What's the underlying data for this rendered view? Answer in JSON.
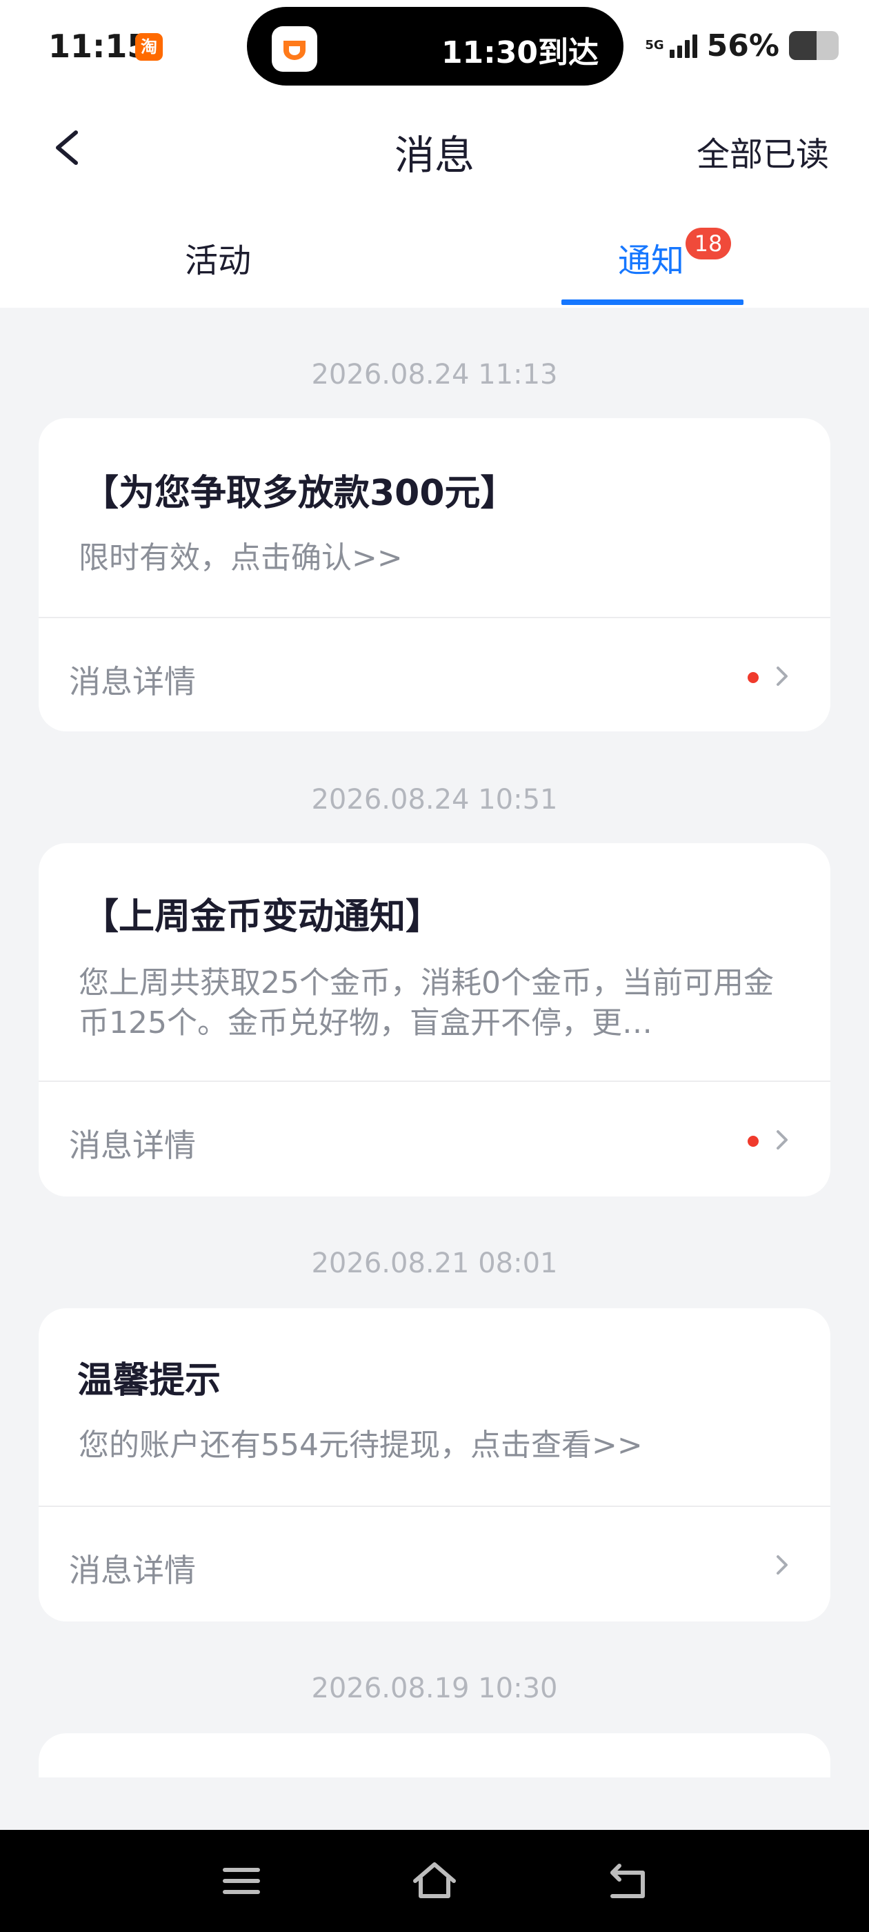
{
  "status_bar": {
    "time": "11:15",
    "app_badge": "淘",
    "island_text": "11:30到达",
    "network": "5G",
    "battery_percent": "56%",
    "battery_level": 0.56
  },
  "header": {
    "title": "消息",
    "read_all": "全部已读"
  },
  "tabs": {
    "activity": "活动",
    "notice": "通知",
    "notice_badge": "18"
  },
  "messages": [
    {
      "timestamp": "2026.08.24 11:13",
      "title": "【为您争取多放款300元】",
      "desc": "限时有效，点击确认>>",
      "footer": "消息详情",
      "unread": true
    },
    {
      "timestamp": "2026.08.24 10:51",
      "title": "【上周金币变动通知】",
      "desc": "您上周共获取25个金币，消耗0个金币，当前可用金币125个。金币兑好物，盲盒开不停，更…",
      "footer": "消息详情",
      "unread": true
    },
    {
      "timestamp": "2026.08.21 08:01",
      "title": "温馨提示",
      "desc": "您的账户还有554元待提现，点击查看>>",
      "footer": "消息详情",
      "unread": false
    },
    {
      "timestamp": "2026.08.19 10:30"
    }
  ],
  "colors": {
    "accent": "#1677ff",
    "badge": "#f04a3a",
    "unread_dot": "#f03a2c",
    "background": "#f3f4f6"
  }
}
